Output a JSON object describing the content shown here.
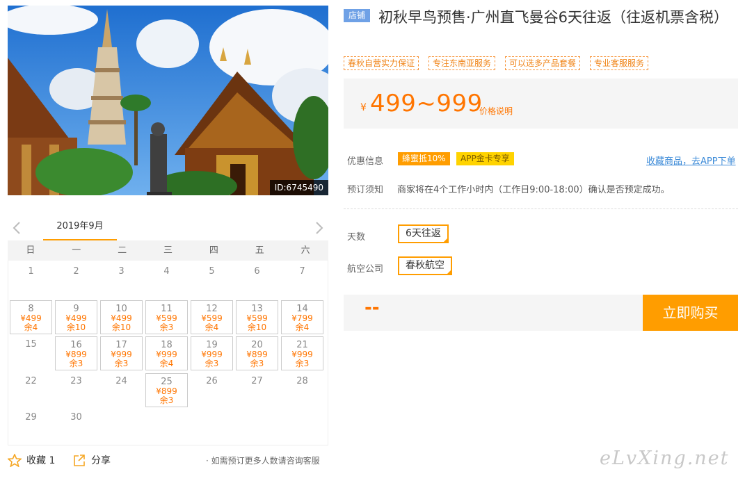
{
  "product": {
    "image_id": "ID:6745490",
    "shop_badge": "店铺",
    "title": "初秋早鸟预售·广州直飞曼谷6天往返（往返机票含税）",
    "tags": [
      "春秋自营实力保证",
      "专注东南亚服务",
      "可以选多产品套餐",
      "专业客服服务"
    ]
  },
  "price": {
    "symbol": "¥",
    "range": "499~999",
    "note": "价格说明"
  },
  "discount": {
    "label": "优惠信息",
    "chips": [
      "蜂蜜抵10%",
      "APP金卡专享"
    ],
    "app_link": "收藏商品，去APP下单"
  },
  "booking_notice": {
    "label": "预订须知",
    "text": "商家将在4个工作小时内（工作日9:00-18:00）确认是否预定成功。"
  },
  "options": {
    "days_label": "天数",
    "days_value": "6天往返",
    "airline_label": "航空公司",
    "airline_value": "春秋航空"
  },
  "buy": {
    "selected_price": "--",
    "button": "立即购买"
  },
  "calendar": {
    "month": "2019年9月",
    "weekdays": [
      "日",
      "一",
      "二",
      "三",
      "四",
      "五",
      "六"
    ],
    "days": [
      {
        "d": "1"
      },
      {
        "d": "2"
      },
      {
        "d": "3"
      },
      {
        "d": "4"
      },
      {
        "d": "5"
      },
      {
        "d": "6"
      },
      {
        "d": "7"
      },
      {
        "d": "8",
        "p": "¥499",
        "r": "余4"
      },
      {
        "d": "9",
        "p": "¥499",
        "r": "余10"
      },
      {
        "d": "10",
        "p": "¥499",
        "r": "余10"
      },
      {
        "d": "11",
        "p": "¥599",
        "r": "余3"
      },
      {
        "d": "12",
        "p": "¥599",
        "r": "余4"
      },
      {
        "d": "13",
        "p": "¥599",
        "r": "余10"
      },
      {
        "d": "14",
        "p": "¥799",
        "r": "余4"
      },
      {
        "d": "15"
      },
      {
        "d": "16",
        "p": "¥899",
        "r": "余3"
      },
      {
        "d": "17",
        "p": "¥999",
        "r": "余3"
      },
      {
        "d": "18",
        "p": "¥999",
        "r": "余4"
      },
      {
        "d": "19",
        "p": "¥999",
        "r": "余3"
      },
      {
        "d": "20",
        "p": "¥899",
        "r": "余3"
      },
      {
        "d": "21",
        "p": "¥999",
        "r": "余3"
      },
      {
        "d": "22"
      },
      {
        "d": "23"
      },
      {
        "d": "24"
      },
      {
        "d": "25",
        "p": "¥899",
        "r": "余3"
      },
      {
        "d": "26"
      },
      {
        "d": "27"
      },
      {
        "d": "28"
      },
      {
        "d": "29"
      },
      {
        "d": "30"
      }
    ]
  },
  "actions": {
    "favorite": "收藏 1",
    "share": "分享",
    "note": "· 如需预订更多人数请咨询客服"
  },
  "watermark": "eLvXing.net",
  "colors": {
    "accent": "#ff9d00",
    "price": "#ff7500",
    "badge": "#6fa1e6",
    "link": "#3d8bd8"
  },
  "icons": [
    "chevron-left-icon",
    "chevron-right-icon",
    "star-icon",
    "share-icon"
  ]
}
